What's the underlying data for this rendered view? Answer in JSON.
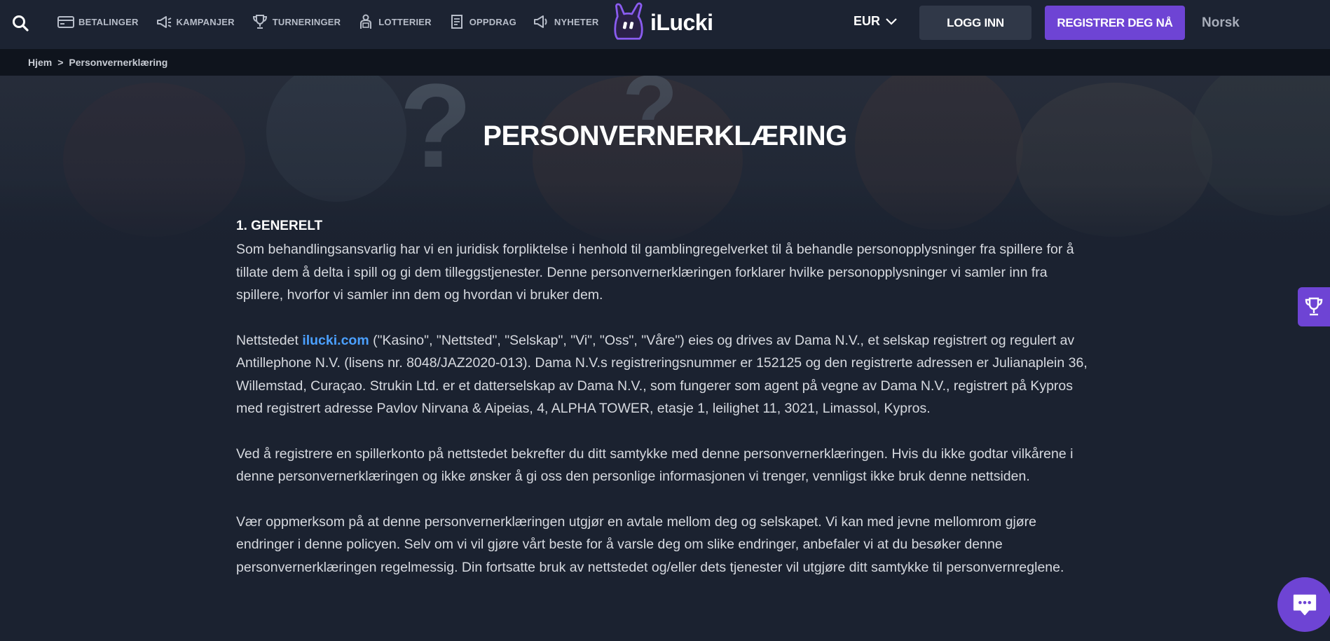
{
  "header": {
    "nav": [
      {
        "label": "BETALINGER",
        "icon": "card-icon"
      },
      {
        "label": "KAMPANJER",
        "icon": "megaphone-icon"
      },
      {
        "label": "TURNERINGER",
        "icon": "trophy-icon"
      },
      {
        "label": "LOTTERIER",
        "icon": "lottery-icon"
      },
      {
        "label": "OPPDRAG",
        "icon": "mission-icon"
      },
      {
        "label": "NYHETER",
        "icon": "news-icon"
      }
    ],
    "logo_text": "iLucki",
    "currency": "EUR",
    "login_label": "LOGG INN",
    "register_label": "REGISTRER DEG NÅ",
    "language": "Norsk"
  },
  "breadcrumb": {
    "home": "Hjem",
    "separator": ">",
    "current": "Personvernerklæring"
  },
  "page": {
    "title": "PERSONVERNERKLÆRING",
    "section_heading": "1. GENERELT",
    "p1": "Som behandlingsansvarlig har vi en juridisk forpliktelse i henhold til gamblingregelverket til å behandle personopplysninger fra spillere for å tillate dem å delta i spill og gi dem tilleggstjenester. Denne personvernerklæringen forklarer hvilke personopplysninger vi samler inn fra spillere, hvorfor vi samler inn dem og hvordan vi bruker dem.",
    "p2_prefix": "Nettstedet ",
    "p2_link": "ilucki.com",
    "p2_rest": " (\"Kasino\", \"Nettsted\", \"Selskap\", \"Vi\", \"Oss\", \"Våre\") eies og drives av Dama N.V., et selskap registrert og regulert av Antillephone N.V. (lisens nr. 8048/JAZ2020-013). Dama N.V.s registreringsnummer er 152125 og den registrerte adressen er Julianaplein 36, Willemstad, Curaçao. Strukin Ltd. er et datterselskap av Dama N.V., som fungerer som agent på vegne av Dama N.V., registrert på Kypros med registrert adresse Pavlov Nirvana & Aipeias, 4, ALPHA TOWER, etasje 1, leilighet 11, 3021, Limassol, Kypros.",
    "p3": "Ved å registrere en spillerkonto på nettstedet bekrefter du ditt samtykke med denne personvernerklæringen. Hvis du ikke godtar vilkårene i denne personvernerklæringen og ikke ønsker å gi oss den personlige informasjonen vi trenger, vennligst ikke bruk denne nettsiden.",
    "p4": "Vær oppmerksom på at denne personvernerklæringen utgjør en avtale mellom deg og selskapet. Vi kan med jevne mellomrom gjøre endringer i denne policyen. Selv om vi vil gjøre vårt beste for å varsle deg om slike endringer, anbefaler vi at du besøker denne personvernerklæringen regelmessig. Din fortsatte bruk av nettstedet og/eller dets tjenester vil utgjøre ditt samtykke til personvernreglene."
  },
  "colors": {
    "accent": "#6e44d4",
    "link": "#4ba0ff",
    "background": "#1b2230"
  }
}
